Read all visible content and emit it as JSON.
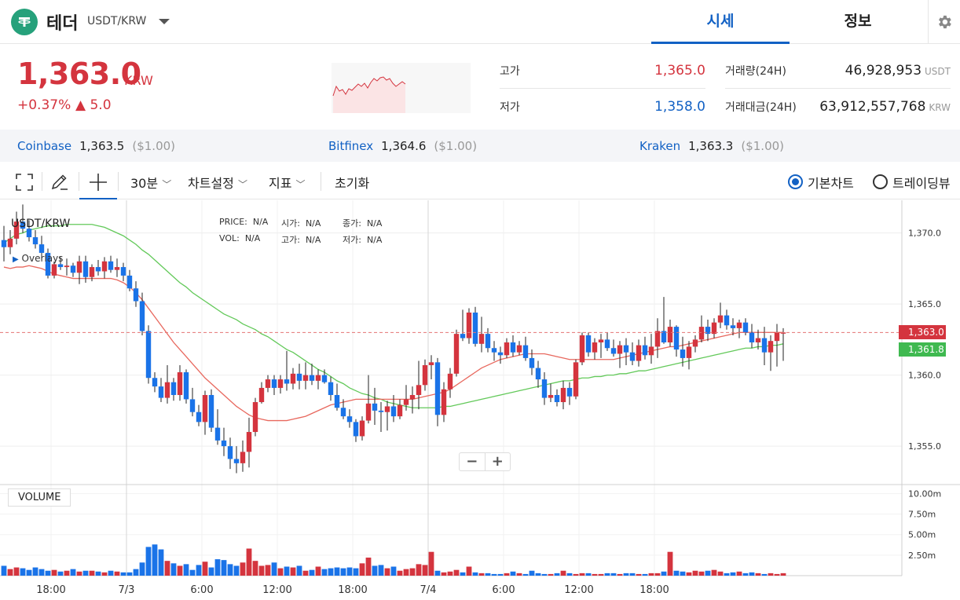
{
  "header": {
    "coin_name": "테더",
    "pair": "USDT/KRW",
    "tabs": [
      "시세",
      "정보"
    ],
    "logo_icon": "tether-logo",
    "settings_icon": "gear-icon"
  },
  "summary": {
    "price": "1,363.0",
    "price_unit": "KRW",
    "change_pct": "+0.37%",
    "change_amt": "▲ 5.0",
    "high_label": "고가",
    "high_value": "1,365.0",
    "low_label": "저가",
    "low_value": "1,358.0",
    "volume_label": "거래량(24H)",
    "volume_value": "46,928,953",
    "volume_unit": "USDT",
    "amount_label": "거래대금(24H)",
    "amount_value": "63,912,557,768",
    "amount_unit": "KRW"
  },
  "exchanges": [
    {
      "name": "Coinbase",
      "price": "1,363.5",
      "usd": "($1.00)"
    },
    {
      "name": "Bitfinex",
      "price": "1,364.6",
      "usd": "($1.00)"
    },
    {
      "name": "Kraken",
      "price": "1,363.3",
      "usd": "($1.00)"
    }
  ],
  "toolbar": {
    "interval": "30분",
    "chart_settings": "차트설정",
    "indicators": "지표",
    "reset": "초기화",
    "basic_chart": "기본차트",
    "tradingview": "트레이딩뷰",
    "selected_view": "기본차트"
  },
  "chart": {
    "symbol": "USDT/KRW",
    "overlays": "Overlays",
    "legend_price_label": "PRICE:",
    "legend_price": "N/A",
    "legend_open_label": "시가:",
    "legend_open": "N/A",
    "legend_close_label": "종가:",
    "legend_close": "N/A",
    "legend_vol_label": "VOL:",
    "legend_vol": "N/A",
    "legend_high_label": "고가:",
    "legend_high": "N/A",
    "legend_low_label": "저가:",
    "legend_low": "N/A",
    "volume_label": "VOLUME",
    "last_price_tag": "1,363.0",
    "ma_tag": "1,361.8",
    "zoom_out": "−",
    "zoom_in": "+",
    "colors": {
      "up": "#d4343e",
      "down": "#1a73e8",
      "ma_short": "#e8685e",
      "ma_long": "#63c95a"
    }
  },
  "chart_data": {
    "type": "candlestick",
    "price_ticks": [
      "1,370.0",
      "1,365.0",
      "1,360.0",
      "1,355.0"
    ],
    "price_tick_values": [
      1370,
      1365,
      1360,
      1355
    ],
    "price_range": [
      1352.3,
      1372.3
    ],
    "volume_ticks": [
      "10.00m",
      "7.50m",
      "5.00m",
      "2.50m"
    ],
    "volume_tick_values": [
      10,
      7.5,
      5,
      2.5
    ],
    "volume_range": [
      0,
      11.1
    ],
    "x_ticks": [
      "18:00",
      "7/3",
      "6:00",
      "12:00",
      "18:00",
      "7/4",
      "6:00",
      "12:00",
      "18:00"
    ],
    "x_tick_index": [
      7.5,
      19.5,
      31.5,
      43.5,
      55.5,
      67.5,
      79.5,
      91.5,
      103.5
    ],
    "candles": [
      [
        1369.5,
        1370.5,
        1368.0,
        1369.0
      ],
      [
        1369.0,
        1370.2,
        1368.5,
        1369.6
      ],
      [
        1369.6,
        1371.5,
        1369.2,
        1370.8
      ],
      [
        1370.8,
        1372.0,
        1370.0,
        1370.3
      ],
      [
        1370.3,
        1370.9,
        1369.4,
        1369.7
      ],
      [
        1369.7,
        1370.2,
        1368.9,
        1369.2
      ],
      [
        1369.2,
        1369.8,
        1368.1,
        1368.6
      ],
      [
        1368.6,
        1368.9,
        1366.8,
        1367.0
      ],
      [
        1367.0,
        1368.0,
        1366.8,
        1367.8
      ],
      [
        1367.8,
        1368.3,
        1367.4,
        1367.6
      ],
      [
        1367.6,
        1368.2,
        1367.0,
        1367.7
      ],
      [
        1367.7,
        1367.9,
        1366.9,
        1367.2
      ],
      [
        1367.2,
        1368.4,
        1366.4,
        1368.0
      ],
      [
        1368.0,
        1368.4,
        1366.5,
        1366.9
      ],
      [
        1366.9,
        1367.8,
        1366.6,
        1367.6
      ],
      [
        1367.6,
        1368.1,
        1367.0,
        1367.3
      ],
      [
        1367.3,
        1368.3,
        1366.8,
        1368.0
      ],
      [
        1368.0,
        1368.4,
        1367.2,
        1367.4
      ],
      [
        1367.4,
        1368.2,
        1366.9,
        1367.6
      ],
      [
        1367.6,
        1367.9,
        1366.6,
        1367.0
      ],
      [
        1367.0,
        1367.4,
        1365.9,
        1366.1
      ],
      [
        1366.1,
        1366.6,
        1364.8,
        1365.2
      ],
      [
        1365.2,
        1365.8,
        1362.8,
        1363.1
      ],
      [
        1363.1,
        1363.5,
        1359.4,
        1359.8
      ],
      [
        1359.8,
        1360.2,
        1358.8,
        1359.2
      ],
      [
        1359.2,
        1359.8,
        1358.1,
        1358.4
      ],
      [
        1358.4,
        1360.7,
        1358.0,
        1359.5
      ],
      [
        1359.5,
        1359.8,
        1358.2,
        1358.6
      ],
      [
        1358.6,
        1360.7,
        1358.2,
        1360.2
      ],
      [
        1360.2,
        1360.4,
        1358.0,
        1358.3
      ],
      [
        1358.3,
        1359.1,
        1357.1,
        1357.4
      ],
      [
        1357.4,
        1357.9,
        1356.4,
        1356.7
      ],
      [
        1356.7,
        1358.9,
        1355.8,
        1358.6
      ],
      [
        1358.6,
        1359.0,
        1356.0,
        1356.3
      ],
      [
        1356.3,
        1357.6,
        1355.1,
        1355.4
      ],
      [
        1355.4,
        1356.3,
        1354.3,
        1355.0
      ],
      [
        1355.0,
        1355.6,
        1353.4,
        1354.1
      ],
      [
        1354.1,
        1355.0,
        1353.1,
        1353.8
      ],
      [
        1353.8,
        1355.4,
        1353.2,
        1354.6
      ],
      [
        1354.6,
        1357.0,
        1353.5,
        1356.0
      ],
      [
        1356.0,
        1358.4,
        1355.7,
        1358.1
      ],
      [
        1358.1,
        1359.5,
        1358.0,
        1359.1
      ],
      [
        1359.1,
        1360.0,
        1358.8,
        1359.7
      ],
      [
        1359.7,
        1360.0,
        1358.6,
        1359.1
      ],
      [
        1359.1,
        1360.0,
        1358.7,
        1359.7
      ],
      [
        1359.7,
        1361.7,
        1358.9,
        1359.4
      ],
      [
        1359.4,
        1360.5,
        1359.0,
        1360.1
      ],
      [
        1360.1,
        1360.8,
        1359.0,
        1359.6
      ],
      [
        1359.6,
        1360.9,
        1359.0,
        1360.0
      ],
      [
        1360.0,
        1360.8,
        1359.3,
        1359.6
      ],
      [
        1359.6,
        1360.4,
        1359.0,
        1360.0
      ],
      [
        1360.0,
        1360.4,
        1359.4,
        1359.5
      ],
      [
        1359.5,
        1359.9,
        1358.2,
        1358.6
      ],
      [
        1358.6,
        1359.4,
        1357.5,
        1357.7
      ],
      [
        1357.7,
        1358.3,
        1356.9,
        1357.1
      ],
      [
        1357.1,
        1357.6,
        1356.3,
        1356.7
      ],
      [
        1356.7,
        1356.9,
        1355.3,
        1355.7
      ],
      [
        1355.7,
        1357.1,
        1355.4,
        1356.8
      ],
      [
        1356.8,
        1360.0,
        1356.6,
        1358.0
      ],
      [
        1358.0,
        1359.1,
        1356.5,
        1357.5
      ],
      [
        1357.5,
        1358.1,
        1356.0,
        1357.4
      ],
      [
        1357.4,
        1358.2,
        1356.1,
        1357.8
      ],
      [
        1357.8,
        1358.6,
        1356.7,
        1357.1
      ],
      [
        1357.1,
        1358.3,
        1356.9,
        1357.9
      ],
      [
        1357.9,
        1359.3,
        1357.5,
        1358.3
      ],
      [
        1358.3,
        1359.2,
        1357.3,
        1358.6
      ],
      [
        1358.6,
        1361.0,
        1357.6,
        1359.3
      ],
      [
        1359.3,
        1361.1,
        1358.9,
        1360.7
      ],
      [
        1360.7,
        1361.4,
        1359.7,
        1360.9
      ],
      [
        1360.9,
        1361.2,
        1356.4,
        1357.2
      ],
      [
        1357.2,
        1359.5,
        1356.7,
        1359.0
      ],
      [
        1359.0,
        1360.5,
        1358.4,
        1360.1
      ],
      [
        1360.1,
        1363.2,
        1359.9,
        1362.9
      ],
      [
        1362.9,
        1364.6,
        1362.4,
        1362.6
      ],
      [
        1362.6,
        1364.7,
        1362.2,
        1364.4
      ],
      [
        1364.4,
        1364.8,
        1362.0,
        1362.2
      ],
      [
        1362.2,
        1364.1,
        1361.6,
        1362.9
      ],
      [
        1362.9,
        1363.3,
        1361.6,
        1361.9
      ],
      [
        1361.9,
        1362.4,
        1361.0,
        1361.6
      ],
      [
        1361.6,
        1362.0,
        1360.8,
        1361.4
      ],
      [
        1361.4,
        1362.6,
        1361.2,
        1362.3
      ],
      [
        1362.3,
        1362.8,
        1361.3,
        1361.6
      ],
      [
        1361.6,
        1362.4,
        1361.4,
        1362.1
      ],
      [
        1362.1,
        1362.7,
        1361.0,
        1361.2
      ],
      [
        1361.2,
        1361.8,
        1360.0,
        1360.5
      ],
      [
        1360.5,
        1361.0,
        1359.1,
        1359.7
      ],
      [
        1359.7,
        1360.2,
        1357.9,
        1358.4
      ],
      [
        1358.4,
        1359.4,
        1358.1,
        1358.6
      ],
      [
        1358.6,
        1359.0,
        1357.8,
        1358.1
      ],
      [
        1358.1,
        1359.6,
        1357.6,
        1359.1
      ],
      [
        1359.1,
        1359.5,
        1357.9,
        1358.5
      ],
      [
        1358.5,
        1361.1,
        1358.3,
        1360.9
      ],
      [
        1360.9,
        1363.0,
        1360.7,
        1362.8
      ],
      [
        1362.8,
        1363.0,
        1361.3,
        1361.6
      ],
      [
        1361.6,
        1362.6,
        1361.1,
        1362.3
      ],
      [
        1362.3,
        1362.9,
        1361.2,
        1362.5
      ],
      [
        1362.5,
        1363.0,
        1361.7,
        1361.9
      ],
      [
        1361.9,
        1362.5,
        1361.3,
        1361.5
      ],
      [
        1361.5,
        1362.4,
        1360.5,
        1362.1
      ],
      [
        1362.1,
        1362.6,
        1360.7,
        1361.6
      ],
      [
        1361.6,
        1362.3,
        1360.7,
        1361.0
      ],
      [
        1361.0,
        1362.5,
        1360.6,
        1362.1
      ],
      [
        1362.1,
        1362.7,
        1361.1,
        1361.4
      ],
      [
        1361.4,
        1362.9,
        1360.8,
        1362.0
      ],
      [
        1362.0,
        1364.0,
        1361.2,
        1363.1
      ],
      [
        1363.1,
        1365.5,
        1362.2,
        1362.3
      ],
      [
        1362.3,
        1363.9,
        1362.0,
        1363.4
      ],
      [
        1363.4,
        1363.5,
        1361.3,
        1361.8
      ],
      [
        1361.8,
        1362.7,
        1360.6,
        1361.2
      ],
      [
        1361.2,
        1362.4,
        1360.4,
        1362.0
      ],
      [
        1362.0,
        1362.8,
        1361.6,
        1362.5
      ],
      [
        1362.5,
        1364.2,
        1362.3,
        1363.4
      ],
      [
        1363.4,
        1363.9,
        1362.4,
        1362.9
      ],
      [
        1362.9,
        1364.0,
        1362.6,
        1363.7
      ],
      [
        1363.7,
        1365.1,
        1363.3,
        1364.2
      ],
      [
        1364.2,
        1364.6,
        1363.2,
        1363.5
      ],
      [
        1363.5,
        1364.0,
        1362.8,
        1363.3
      ],
      [
        1363.3,
        1363.9,
        1362.6,
        1363.7
      ],
      [
        1363.7,
        1364.0,
        1362.8,
        1363.0
      ],
      [
        1363.0,
        1363.6,
        1361.9,
        1362.3
      ],
      [
        1362.3,
        1363.2,
        1361.8,
        1362.6
      ],
      [
        1362.6,
        1363.4,
        1360.7,
        1361.6
      ],
      [
        1361.6,
        1362.8,
        1360.3,
        1362.4
      ],
      [
        1362.4,
        1363.6,
        1360.6,
        1363.0
      ],
      [
        1363.0,
        1363.3,
        1361.0,
        1363.0
      ]
    ],
    "ma_short": [
      1367.6,
      1367.5,
      1367.6,
      1367.6,
      1367.7,
      1367.6,
      1367.5,
      1367.3,
      1367.1,
      1367.0,
      1366.9,
      1366.8,
      1366.8,
      1366.8,
      1366.8,
      1366.8,
      1366.8,
      1366.8,
      1366.7,
      1366.5,
      1366.2,
      1365.8,
      1365.3,
      1364.7,
      1364.1,
      1363.5,
      1362.9,
      1362.3,
      1361.8,
      1361.3,
      1360.8,
      1360.3,
      1359.8,
      1359.4,
      1359.0,
      1358.6,
      1358.2,
      1357.8,
      1357.5,
      1357.2,
      1357.0,
      1356.9,
      1356.8,
      1356.8,
      1356.8,
      1356.8,
      1356.9,
      1357.0,
      1357.1,
      1357.3,
      1357.5,
      1357.7,
      1357.9,
      1358.0,
      1358.1,
      1358.2,
      1358.3,
      1358.3,
      1358.3,
      1358.3,
      1358.3,
      1358.3,
      1358.3,
      1358.3,
      1358.3,
      1358.3,
      1358.4,
      1358.5,
      1358.6,
      1358.7,
      1358.8,
      1359.0,
      1359.3,
      1359.6,
      1359.9,
      1360.2,
      1360.5,
      1360.7,
      1360.9,
      1361.1,
      1361.2,
      1361.3,
      1361.4,
      1361.5,
      1361.5,
      1361.5,
      1361.5,
      1361.4,
      1361.3,
      1361.2,
      1361.1,
      1361.1,
      1361.1,
      1361.1,
      1361.1,
      1361.1,
      1361.1,
      1361.1,
      1361.2,
      1361.3,
      1361.4,
      1361.5,
      1361.6,
      1361.7,
      1361.8,
      1361.9,
      1362.0,
      1362.0,
      1362.1,
      1362.2,
      1362.3,
      1362.4,
      1362.5,
      1362.6,
      1362.7,
      1362.8,
      1362.9,
      1363.0,
      1363.0,
      1363.0,
      1363.0,
      1363.0,
      1363.0,
      1363.0,
      1363.0
    ],
    "ma_long": [
      1369.3,
      1369.6,
      1369.9,
      1370.0,
      1370.2,
      1370.3,
      1370.4,
      1370.5,
      1370.5,
      1370.5,
      1370.6,
      1370.6,
      1370.6,
      1370.6,
      1370.6,
      1370.5,
      1370.4,
      1370.2,
      1370.0,
      1369.8,
      1369.5,
      1369.2,
      1368.8,
      1368.5,
      1368.1,
      1367.7,
      1367.3,
      1366.9,
      1366.5,
      1366.2,
      1365.8,
      1365.5,
      1365.2,
      1364.9,
      1364.6,
      1364.3,
      1364.1,
      1363.9,
      1363.6,
      1363.4,
      1363.2,
      1362.9,
      1362.7,
      1362.4,
      1362.1,
      1361.8,
      1361.6,
      1361.3,
      1361.0,
      1360.7,
      1360.4,
      1360.2,
      1359.9,
      1359.6,
      1359.4,
      1359.1,
      1358.9,
      1358.7,
      1358.6,
      1358.4,
      1358.3,
      1358.1,
      1358.0,
      1357.9,
      1357.8,
      1357.7,
      1357.7,
      1357.7,
      1357.7,
      1357.7,
      1357.8,
      1357.8,
      1357.9,
      1358.0,
      1358.1,
      1358.2,
      1358.3,
      1358.4,
      1358.5,
      1358.6,
      1358.7,
      1358.8,
      1358.9,
      1359.0,
      1359.1,
      1359.2,
      1359.3,
      1359.4,
      1359.5,
      1359.6,
      1359.6,
      1359.7,
      1359.8,
      1359.8,
      1359.9,
      1359.9,
      1360.0,
      1360.0,
      1360.1,
      1360.1,
      1360.2,
      1360.3,
      1360.3,
      1360.4,
      1360.5,
      1360.6,
      1360.7,
      1360.8,
      1360.9,
      1361.0,
      1361.1,
      1361.2,
      1361.3,
      1361.4,
      1361.5,
      1361.6,
      1361.7,
      1361.8,
      1361.9,
      1361.9,
      1362.0,
      1362.0,
      1362.1,
      1362.1,
      1362.2
    ],
    "volumes": [
      1.2,
      0.8,
      1.0,
      0.9,
      0.7,
      1.0,
      0.8,
      0.6,
      0.7,
      0.5,
      0.6,
      0.8,
      0.5,
      0.6,
      0.6,
      0.5,
      0.4,
      0.6,
      0.5,
      0.4,
      0.4,
      0.8,
      1.6,
      3.5,
      3.8,
      3.2,
      1.8,
      1.5,
      1.2,
      1.4,
      0.7,
      1.3,
      1.7,
      1.0,
      2.0,
      1.9,
      1.4,
      1.2,
      1.6,
      3.3,
      1.8,
      1.2,
      1.3,
      1.6,
      0.9,
      1.1,
      1.0,
      1.2,
      0.6,
      0.7,
      1.1,
      0.8,
      0.9,
      1.0,
      0.9,
      1.0,
      0.9,
      1.5,
      2.2,
      1.2,
      1.3,
      0.9,
      1.1,
      0.6,
      0.8,
      0.9,
      1.4,
      1.3,
      2.9,
      0.6,
      0.4,
      0.5,
      0.7,
      0.4,
      1.1,
      0.4,
      0.3,
      0.3,
      0.2,
      0.2,
      0.3,
      0.5,
      0.3,
      0.2,
      0.6,
      0.3,
      0.2,
      0.2,
      0.3,
      0.6,
      0.3,
      0.2,
      0.3,
      0.3,
      0.2,
      0.2,
      0.3,
      0.3,
      0.2,
      0.3,
      0.3,
      0.2,
      0.2,
      0.3,
      0.3,
      0.5,
      2.9,
      0.6,
      0.5,
      0.4,
      0.6,
      0.5,
      0.6,
      0.7,
      0.5,
      0.3,
      0.4,
      0.5,
      0.3,
      0.4,
      0.3,
      0.2,
      0.3,
      0.2,
      0.3
    ],
    "volume_colors_up": true,
    "last_price": 1363.0,
    "ma_last": 1361.8
  }
}
